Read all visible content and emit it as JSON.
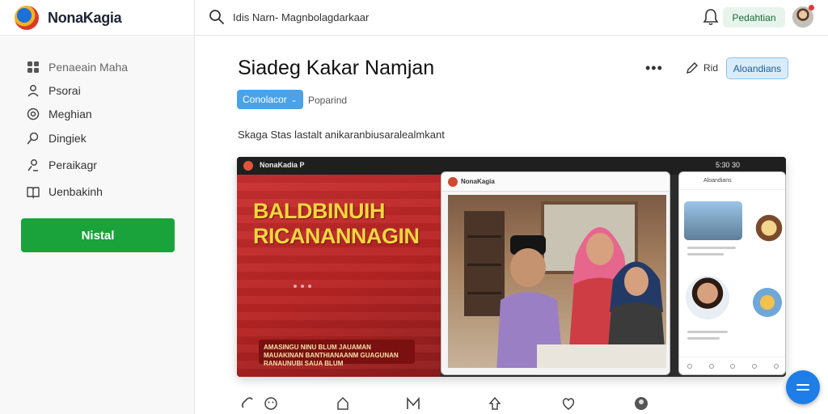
{
  "app": {
    "name": "NonaKagia"
  },
  "header": {
    "search_text": "Idis Narn- Magnbolagdarkaar",
    "action_button": "Pedahtian"
  },
  "sidebar": {
    "items": [
      {
        "label": "Penaeain Maha",
        "icon": "grid-icon"
      },
      {
        "label": "Psorai",
        "icon": "people-icon"
      },
      {
        "label": "Meghian",
        "icon": "target-icon"
      },
      {
        "label": "Dingiek",
        "icon": "search-icon"
      },
      {
        "label": "Peraikagr",
        "icon": "user-icon"
      },
      {
        "label": "Uenbakinh",
        "icon": "book-icon"
      }
    ],
    "install_button": "Nistal"
  },
  "main": {
    "title": "Siadeg Kakar Namjan",
    "edit_label": "Rid",
    "primary_button": "Aloandians",
    "tag_select": "Conolacor",
    "tag_label": "Poparind",
    "description": "Skaga Stas lastalt anikaranbiusaralealmkant"
  },
  "hero": {
    "topbar_title": "NonaKadia P",
    "topbar_status": "5:30 30",
    "heading_line1": "BALDBINUIH",
    "heading_line2": "RICANANNAGIN",
    "caption": "AMASINGU NINU BLUM JAUAMAN MAUAKINAN BANTHIANAANM GUAGUNAN RANAUNUBI SAUA BLUM",
    "window_title": "NonaKagia",
    "side_window_title": "Aloandians"
  },
  "colors": {
    "brand_green": "#19a33a",
    "accent_blue": "#1e7de6",
    "hero_red": "#c93030",
    "hero_yellow": "#f3d640"
  }
}
